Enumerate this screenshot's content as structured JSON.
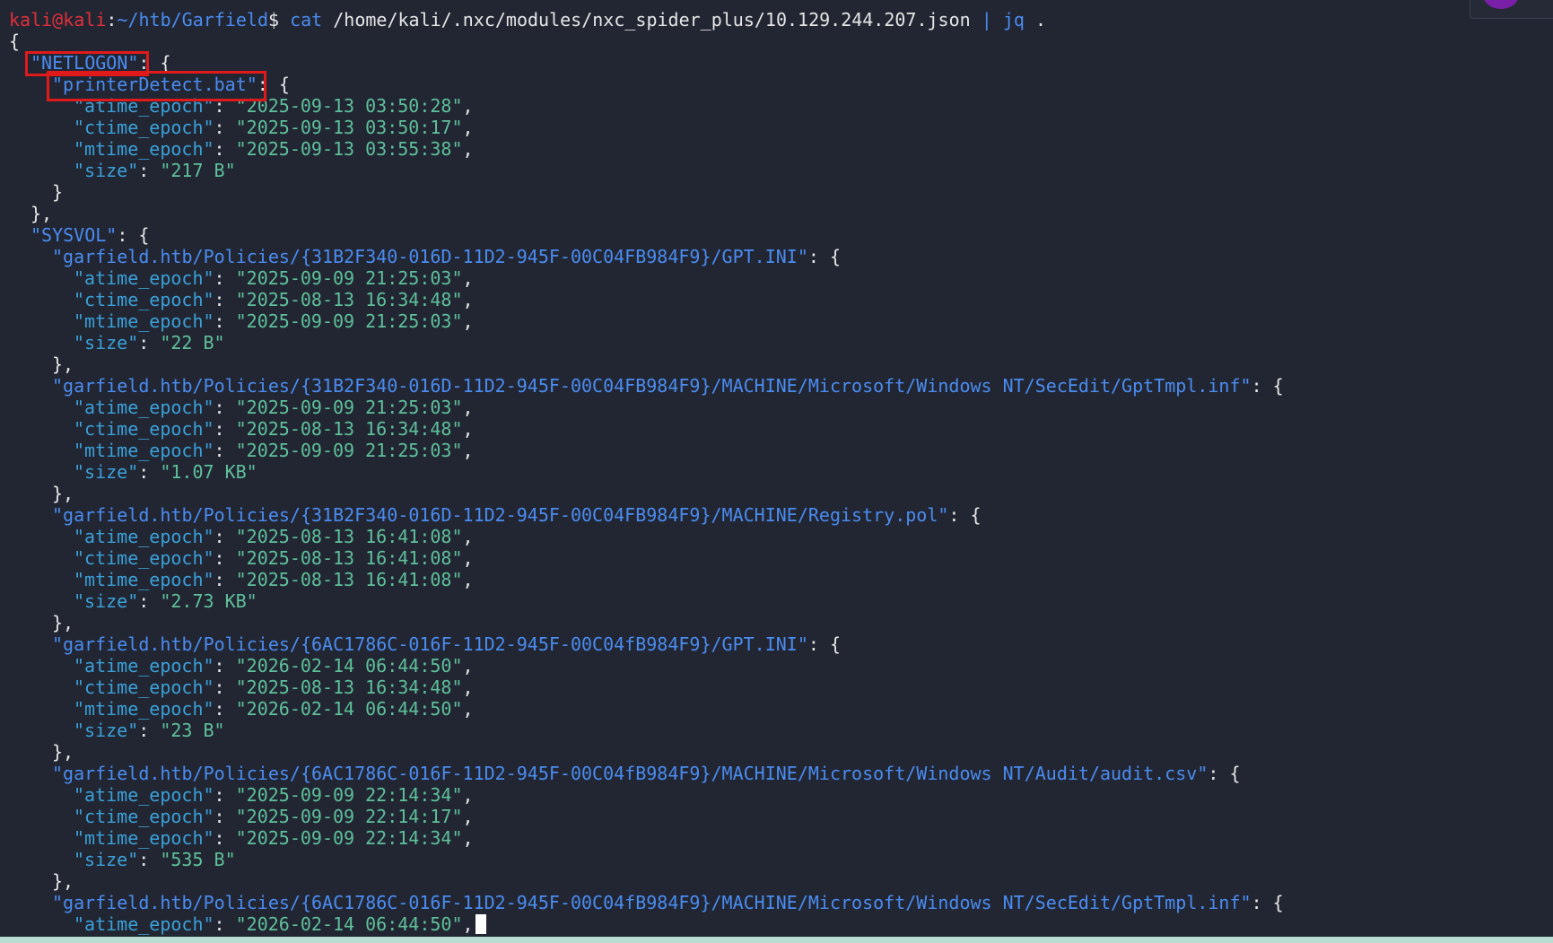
{
  "prompt": {
    "user_host": "kali@kali",
    "separator": ":",
    "path": "~/htb/Garfield",
    "dollar": "$ ",
    "command_name": "cat",
    "command_args": " /home/kali/.nxc/modules/nxc_spider_plus/10.129.244.207.json ",
    "pipe": "|",
    "jq": " jq",
    "jq_arg": " ."
  },
  "punctuation": {
    "open_brace": "{",
    "close_brace": "}",
    "close_brace_comma": "},",
    "colon_brace": ": {",
    "colon": ": ",
    "comma": ","
  },
  "json": {
    "shares": [
      {
        "name": "\"NETLOGON\"",
        "files": [
          {
            "path": "\"printerDetect.bat\"",
            "atime": "\"2025-09-13 03:50:28\"",
            "ctime": "\"2025-09-13 03:50:17\"",
            "mtime": "\"2025-09-13 03:55:38\"",
            "size": "\"217 B\""
          }
        ]
      },
      {
        "name": "\"SYSVOL\"",
        "files": [
          {
            "path": "\"garfield.htb/Policies/{31B2F340-016D-11D2-945F-00C04FB984F9}/GPT.INI\"",
            "atime": "\"2025-09-09 21:25:03\"",
            "ctime": "\"2025-08-13 16:34:48\"",
            "mtime": "\"2025-09-09 21:25:03\"",
            "size": "\"22 B\""
          },
          {
            "path": "\"garfield.htb/Policies/{31B2F340-016D-11D2-945F-00C04FB984F9}/MACHINE/Microsoft/Windows NT/SecEdit/GptTmpl.inf\"",
            "atime": "\"2025-09-09 21:25:03\"",
            "ctime": "\"2025-08-13 16:34:48\"",
            "mtime": "\"2025-09-09 21:25:03\"",
            "size": "\"1.07 KB\""
          },
          {
            "path": "\"garfield.htb/Policies/{31B2F340-016D-11D2-945F-00C04FB984F9}/MACHINE/Registry.pol\"",
            "atime": "\"2025-08-13 16:41:08\"",
            "ctime": "\"2025-08-13 16:41:08\"",
            "mtime": "\"2025-08-13 16:41:08\"",
            "size": "\"2.73 KB\""
          },
          {
            "path": "\"garfield.htb/Policies/{6AC1786C-016F-11D2-945F-00C04fB984F9}/GPT.INI\"",
            "atime": "\"2026-02-14 06:44:50\"",
            "ctime": "\"2025-08-13 16:34:48\"",
            "mtime": "\"2026-02-14 06:44:50\"",
            "size": "\"23 B\""
          },
          {
            "path": "\"garfield.htb/Policies/{6AC1786C-016F-11D2-945F-00C04fB984F9}/MACHINE/Microsoft/Windows NT/Audit/audit.csv\"",
            "atime": "\"2025-09-09 22:14:34\"",
            "ctime": "\"2025-09-09 22:14:17\"",
            "mtime": "\"2025-09-09 22:14:34\"",
            "size": "\"535 B\""
          },
          {
            "path": "\"garfield.htb/Policies/{6AC1786C-016F-11D2-945F-00C04fB984F9}/MACHINE/Microsoft/Windows NT/SecEdit/GptTmpl.inf\"",
            "atime": "\"2026-02-14 06:44:50\""
          }
        ]
      }
    ],
    "field_names": {
      "atime": "\"atime_epoch\"",
      "ctime": "\"ctime_epoch\"",
      "mtime": "\"mtime_epoch\"",
      "size": "\"size\""
    }
  },
  "colors": {
    "background": "#222633",
    "prompt_user": "#e0303a",
    "path_blue": "#4a8cf0",
    "field_blue": "#3aa0d8",
    "string_green": "#5ec09a",
    "highlight_red": "#e01a1a",
    "status_bar": "#b8ddd3"
  }
}
